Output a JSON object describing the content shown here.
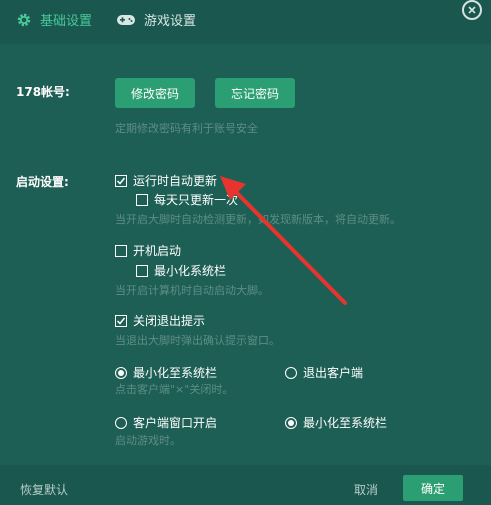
{
  "tabs": [
    {
      "label": "基础设置",
      "icon": "gear-icon"
    },
    {
      "label": "游戏设置",
      "icon": "gamepad-icon"
    }
  ],
  "account": {
    "label": "178帐号:",
    "change_password": "修改密码",
    "forgot_password": "忘记密码",
    "hint": "定期修改密码有利于账号安全"
  },
  "startup": {
    "label": "启动设置:",
    "auto_update": "运行时自动更新",
    "daily_update": "每天只更新一次",
    "update_hint": "当开启大脚时自动检测更新，如发现新版本，将自动更新。",
    "boot_start": "开机启动",
    "minimize_tray": "最小化系统栏",
    "boot_hint": "当开启计算机时自动启动大脚。",
    "exit_prompt": "关闭退出提示",
    "exit_hint": "当退出大脚时弹出确认提示窗口。",
    "close_minimize": "最小化至系统栏",
    "close_exit": "退出客户端",
    "close_hint": "点击客户端\"×\"关闭时。",
    "game_open_client": "客户端窗口开启",
    "game_minimize": "最小化至系统栏",
    "game_hint": "启动游戏时。"
  },
  "footer": {
    "restore_default": "恢复默认",
    "cancel": "取消",
    "confirm": "确定"
  },
  "colors": {
    "background": "#1d5f55",
    "accent": "#2b9e73",
    "active_tab": "#49c99a",
    "arrow": "#e8342e"
  }
}
